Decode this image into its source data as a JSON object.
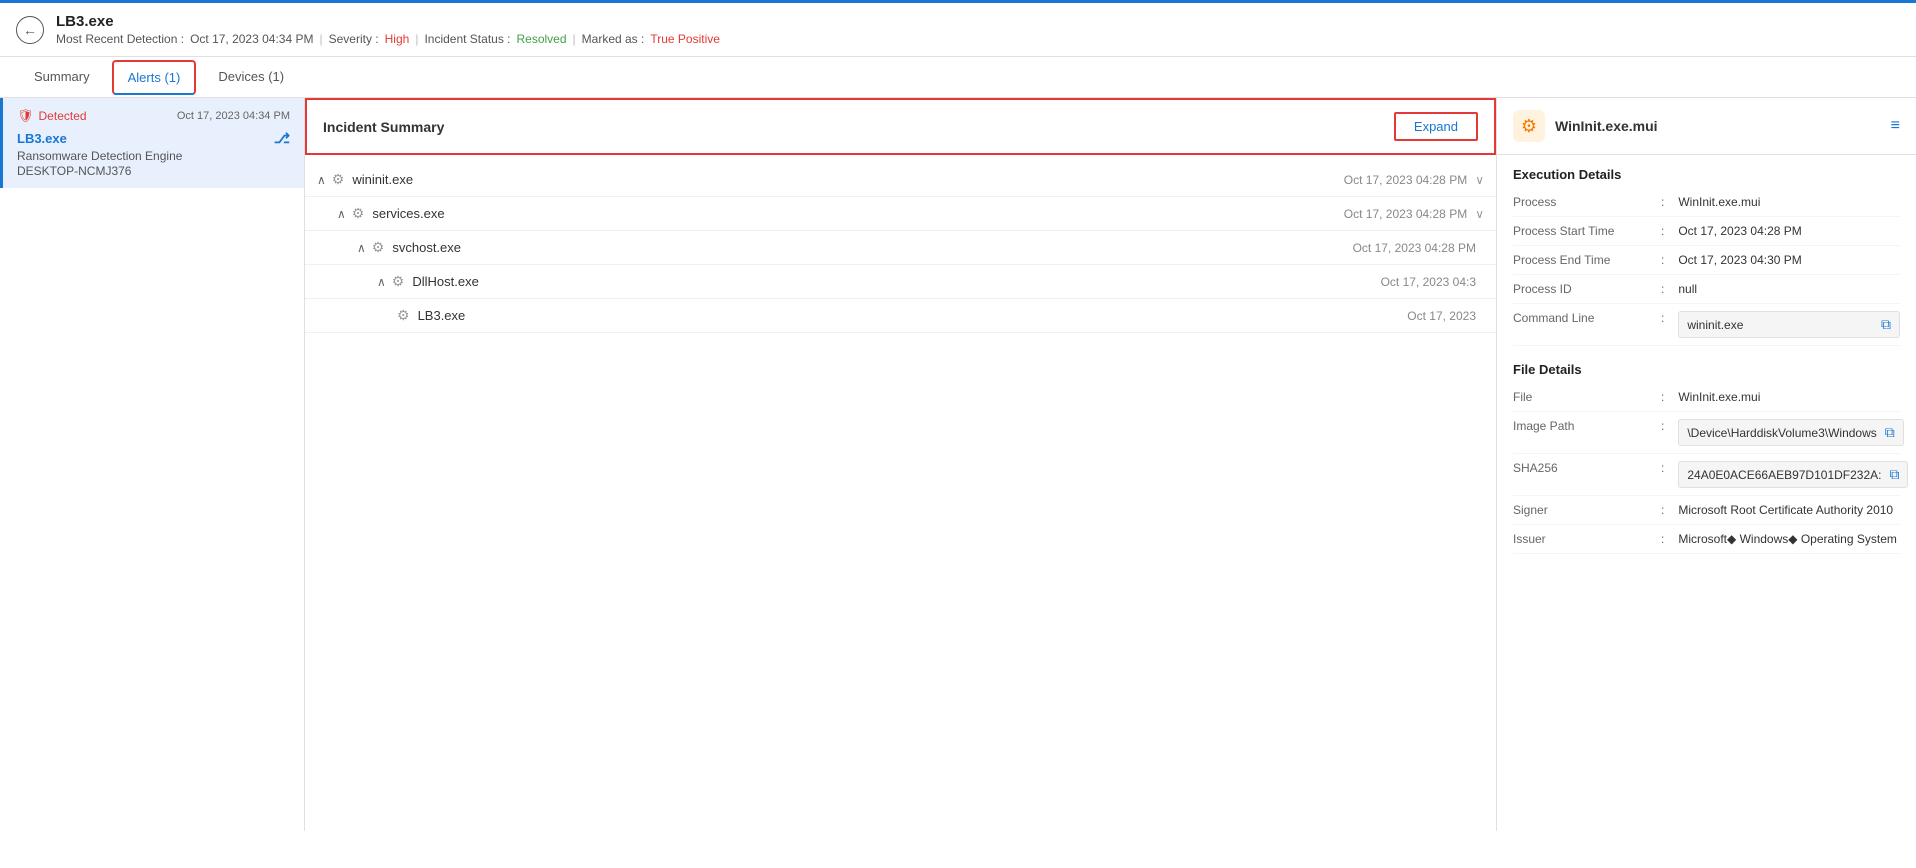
{
  "topAccentBar": {},
  "header": {
    "backLabel": "←",
    "title": "LB3.exe",
    "meta": {
      "detectionLabel": "Most Recent Detection :",
      "detectionTime": "Oct 17, 2023 04:34 PM",
      "sep1": "|",
      "severityLabel": "Severity :",
      "severity": "High",
      "sep2": "|",
      "statusLabel": "Incident Status :",
      "status": "Resolved",
      "sep3": "|",
      "markedLabel": "Marked as :",
      "marked": "True Positive"
    }
  },
  "tabs": {
    "summary": "Summary",
    "alerts": "Alerts (1)",
    "devices": "Devices (1)"
  },
  "leftPanel": {
    "detectedLabel": "Detected",
    "detectedTime": "Oct 17, 2023 04:34 PM",
    "alertName": "LB3.exe",
    "engine": "Ransomware Detection Engine",
    "device": "DESKTOP-NCMJ376"
  },
  "incidentSummary": {
    "title": "Incident Summary",
    "expandLabel": "Expand"
  },
  "tree": [
    {
      "id": "wininit",
      "name": "wininit.exe",
      "time": "Oct 17, 2023 04:28 PM",
      "indent": 0,
      "hasChevron": true,
      "chevronDir": "up"
    },
    {
      "id": "services",
      "name": "services.exe",
      "time": "Oct 17, 2023 04:28 PM",
      "indent": 1,
      "hasChevron": true,
      "chevronDir": "up"
    },
    {
      "id": "svchost",
      "name": "svchost.exe",
      "time": "Oct 17, 2023 04:28 PM",
      "indent": 2,
      "hasChevron": true,
      "chevronDir": "up"
    },
    {
      "id": "dllhost",
      "name": "DllHost.exe",
      "time": "Oct 17, 2023 04:3",
      "indent": 3,
      "hasChevron": true,
      "chevronDir": "up"
    },
    {
      "id": "lb3",
      "name": "LB3.exe",
      "time": "Oct 17, 2023",
      "indent": 4,
      "hasChevron": false,
      "chevronDir": ""
    }
  ],
  "rightPanel": {
    "title": "WinInit.exe.mui",
    "executionDetails": {
      "sectionTitle": "Execution Details",
      "rows": [
        {
          "label": "Process",
          "value": "WinInit.exe.mui",
          "hasBox": false
        },
        {
          "label": "Process Start Time",
          "value": "Oct 17, 2023 04:28 PM",
          "hasBox": false
        },
        {
          "label": "Process End Time",
          "value": "Oct 17, 2023 04:30 PM",
          "hasBox": false
        },
        {
          "label": "Process ID",
          "value": "null",
          "hasBox": false
        },
        {
          "label": "Command Line",
          "value": "wininit.exe",
          "hasBox": true
        }
      ]
    },
    "fileDetails": {
      "sectionTitle": "File Details",
      "rows": [
        {
          "label": "File",
          "value": "WinInit.exe.mui",
          "hasBox": false
        },
        {
          "label": "Image Path",
          "value": "\\Device\\HarddiskVolume3\\Windows",
          "hasBox": true
        },
        {
          "label": "SHA256",
          "value": "24A0E0ACE66AEB97D101DF232A:",
          "hasBox": true
        },
        {
          "label": "Signer",
          "value": "Microsoft Root Certificate Authority 2010",
          "hasBox": false
        },
        {
          "label": "Issuer",
          "value": "Microsoft◆ Windows◆ Operating System",
          "hasBox": false
        }
      ]
    }
  }
}
